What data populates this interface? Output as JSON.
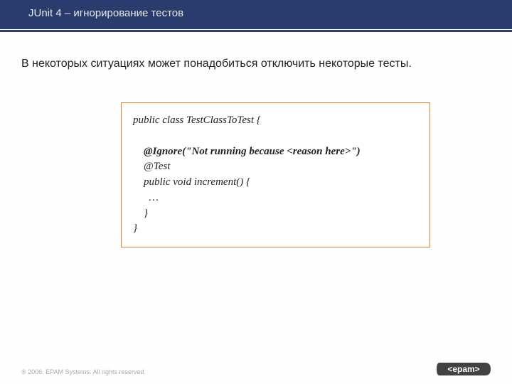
{
  "title": "JUnit 4 – игнорирование тестов",
  "intro": "В некоторых ситуациях может понадобиться отключить некоторые тесты.",
  "code": {
    "line1": "public class TestClassToTest {",
    "blank1": " ",
    "line2": "    @Ignore(\"Not running because <reason here>\")",
    "line3": "    @Test",
    "line4": "    public void increment() {",
    "line5": "      …",
    "line6": "    }",
    "line7": "}"
  },
  "footer": "® 2006. EPAM Systems. All rights reserved.",
  "logo_text": "<epam>"
}
